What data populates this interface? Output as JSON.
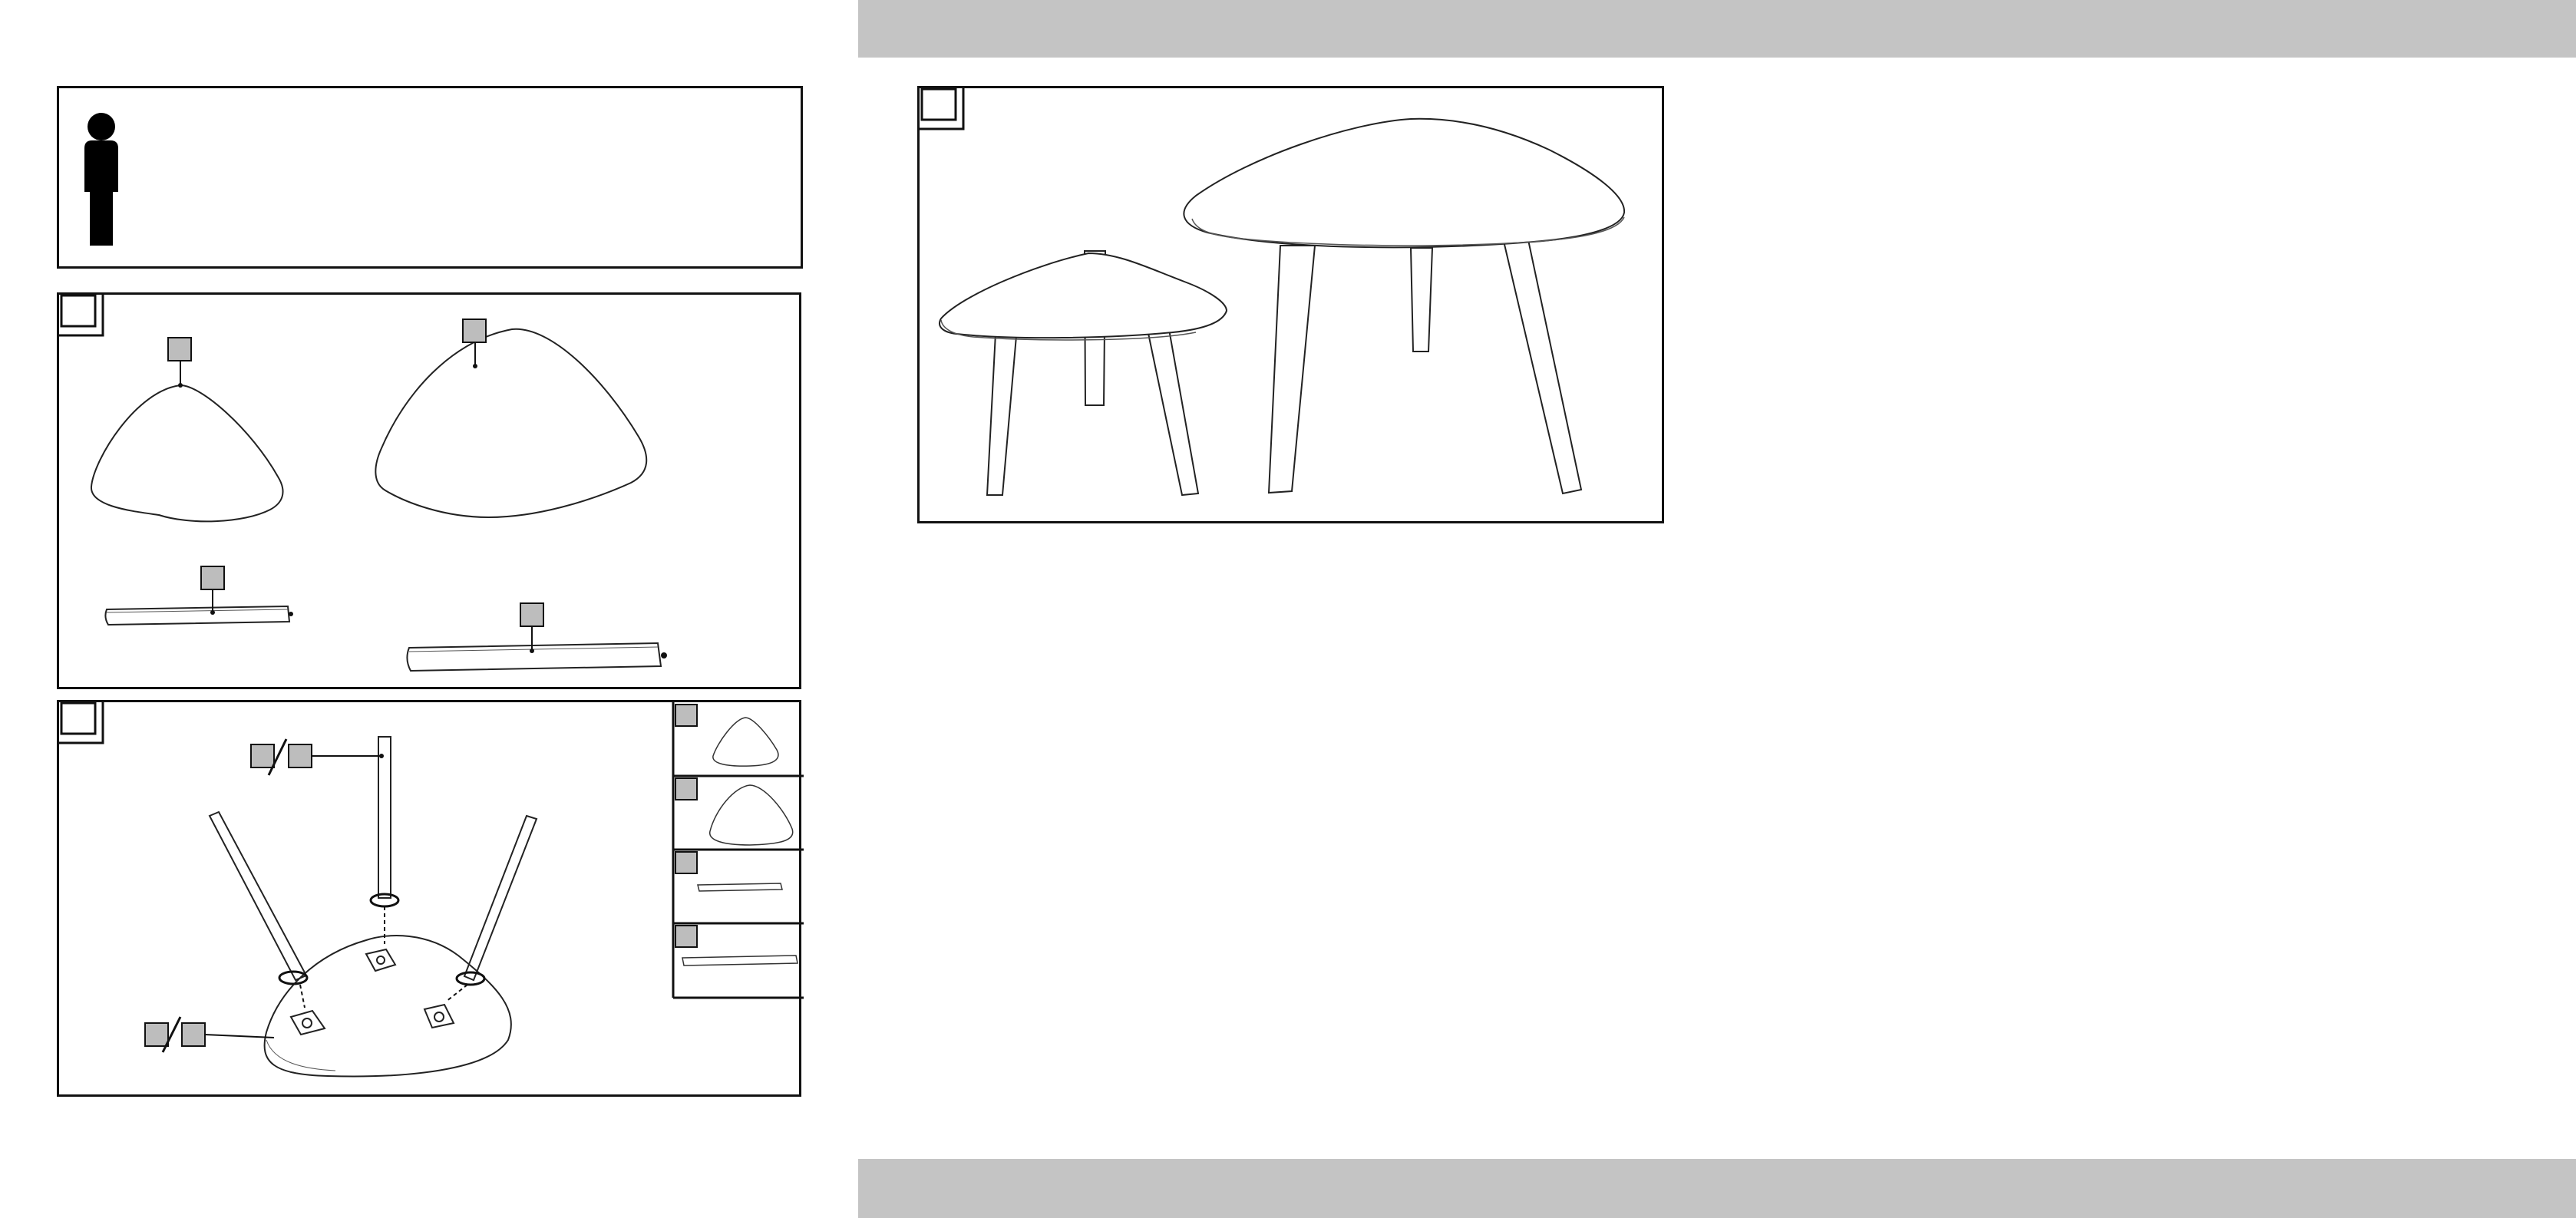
{
  "colors": {
    "band": "#c4c4c4",
    "line": "#111111",
    "label_box": "#bdbdbd",
    "background": "#ffffff"
  },
  "icons": {
    "person": "single-person-icon"
  },
  "step_numbers": {
    "parts": "",
    "assembly": "",
    "result": ""
  }
}
